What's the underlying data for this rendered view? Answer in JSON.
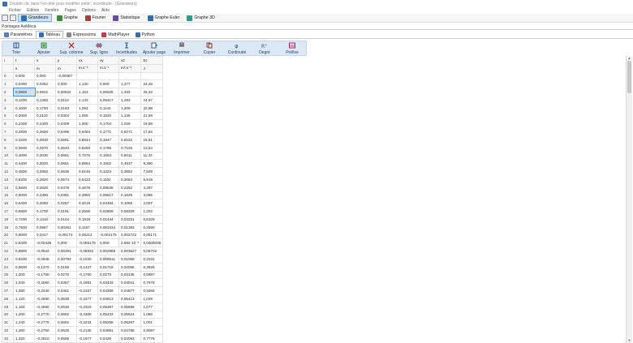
{
  "window": {
    "title": "Double clic dans l'en-tête pour modifier unité ; incertitude - [Grandeurs]"
  },
  "menu": [
    "Fichier",
    "Edition",
    "Fenêtre",
    "Pages",
    "Options",
    "Aide"
  ],
  "topbar": {
    "buttons": [
      {
        "label": "Grandeurs",
        "icon": "table-icon",
        "active": true,
        "color": "#2f6db5"
      },
      {
        "label": "Graphe",
        "icon": "graph-icon",
        "active": false,
        "color": "#3a8a3a"
      },
      {
        "label": "Fourier",
        "icon": "fourier-icon",
        "active": false,
        "color": "#b23a3a"
      },
      {
        "label": "Statistique",
        "icon": "stats-icon",
        "active": false,
        "color": "#6a4aa8"
      },
      {
        "label": "Graphe Euler",
        "icon": "euler-icon",
        "active": false,
        "color": "#2f6db5"
      },
      {
        "label": "Graphe 3D",
        "icon": "graph3d-icon",
        "active": false,
        "color": "#2f9a8a"
      }
    ]
  },
  "section": {
    "label": "Pointages AviMéca"
  },
  "tabs": [
    {
      "label": "Paramètres",
      "icon": "params-icon",
      "active": false
    },
    {
      "label": "Tableau",
      "icon": "table-icon",
      "active": true
    },
    {
      "label": "Expressions",
      "icon": "expressions-icon",
      "active": false
    },
    {
      "label": "MathPlayer",
      "icon": "mathplayer-icon",
      "active": false
    },
    {
      "label": "Python",
      "icon": "python-icon",
      "active": false
    }
  ],
  "toolbar": [
    {
      "label": "Trier",
      "icon": "sort-icon",
      "color": "#2a55a0"
    },
    {
      "label": "Ajouter",
      "icon": "add-icon",
      "color": "#2a8a3a"
    },
    {
      "label": "Sup. colonne",
      "icon": "delete-column-icon",
      "color": "#c03030"
    },
    {
      "label": "Sup. ligne",
      "icon": "delete-row-icon",
      "color": "#c03030"
    },
    {
      "label": "Incertitudes",
      "icon": "uncertainty-icon",
      "color": "#2a55a0"
    },
    {
      "label": "Ajouter page",
      "icon": "add-page-icon",
      "color": "#2a55a0"
    },
    {
      "label": "Imprimer",
      "icon": "print-icon",
      "color": "#444444"
    },
    {
      "label": "Copier",
      "icon": "copy-icon",
      "color": "#7a3a3a"
    },
    {
      "label": "Continuité",
      "icon": "continuity-icon",
      "color": "#2a55a0"
    },
    {
      "label": "Degré",
      "icon": "degree-icon",
      "color": "#2a55a0"
    },
    {
      "label": "Préfixe",
      "icon": "prefix-icon",
      "color": "#a03070"
    }
  ],
  "table": {
    "headers": [
      "i",
      "t",
      "x",
      "y",
      "vx",
      "vy",
      "v2",
      "Ec"
    ],
    "units": [
      "",
      "s",
      "m",
      "m",
      "m.s⁻¹",
      "m.s⁻¹",
      "m².s⁻²",
      "J"
    ],
    "rows": [
      [
        "0",
        "0,000",
        "0,000",
        "-0,00087",
        "",
        "",
        "",
        ""
      ],
      [
        "1",
        "0,0400",
        "0,0452",
        "0,000",
        "1,130",
        "0,000",
        "1,277",
        "24,26"
      ],
      [
        "2",
        "0,0800",
        "0,0922",
        "0,00522",
        "1,153",
        "0,06525",
        "1,333",
        "25,32"
      ],
      [
        "3",
        "0,1200",
        "0,1360",
        "0,0113",
        "1,133",
        "0,09417",
        "1,293",
        "24,57"
      ],
      [
        "4",
        "0,1600",
        "0,1750",
        "0,0183",
        "1,094",
        "0,1144",
        "1,209",
        "22,98"
      ],
      [
        "5",
        "0,2000",
        "0,2110",
        "0,0304",
        "1,055",
        "0,1520",
        "1,136",
        "21,59"
      ],
      [
        "6",
        "0,2400",
        "0,2400",
        "0,0409",
        "1,000",
        "0,1704",
        "1,029",
        "19,55"
      ],
      [
        "7",
        "0,2800",
        "0,2650",
        "0,0496",
        "0,9464",
        "0,1771",
        "0,9271",
        "17,62"
      ],
      [
        "8",
        "0,3200",
        "0,2830",
        "0,0591",
        "0,8844",
        "0,1847",
        "0,8162",
        "15,51"
      ],
      [
        "9",
        "0,3600",
        "0,2970",
        "0,0643",
        "0,8250",
        "0,1786",
        "0,7125",
        "13,54"
      ],
      [
        "10",
        "0,4000",
        "0,3030",
        "0,0661",
        "0,7575",
        "0,1653",
        "0,6011",
        "11,42"
      ],
      [
        "11",
        "0,4400",
        "0,3020",
        "0,0661",
        "0,6864",
        "0,1502",
        "0,4937",
        "9,380"
      ],
      [
        "12",
        "0,4800",
        "0,2950",
        "0,0635",
        "0,6146",
        "0,1323",
        "0,3952",
        "7,509"
      ],
      [
        "13",
        "0,5200",
        "0,2820",
        "0,0574",
        "0,5423",
        "0,1104",
        "0,3063",
        "5,819"
      ],
      [
        "14",
        "0,5600",
        "0,2620",
        "0,0478",
        "0,4679",
        "0,08536",
        "0,2262",
        "4,297"
      ],
      [
        "15",
        "0,6000",
        "0,2390",
        "0,0391",
        "0,3983",
        "0,06517",
        "0,1629",
        "3,095"
      ],
      [
        "16",
        "0,6400",
        "0,2060",
        "0,0287",
        "0,3219",
        "0,04484",
        "0,1056",
        "2,007"
      ],
      [
        "17",
        "0,6800",
        "0,1700",
        "0,0191",
        "0,2500",
        "0,02809",
        "0,06329",
        "1,202"
      ],
      [
        "18",
        "0,7200",
        "0,1310",
        "0,0104",
        "0,1819",
        "0,01444",
        "0,03331",
        "0,6329"
      ],
      [
        "19",
        "0,7600",
        "0,0887",
        "0,00261",
        "0,1167",
        "0,003434",
        "0,01363",
        "0,2590"
      ],
      [
        "20",
        "0,8000",
        "0,0417",
        "-0,00174",
        "0,05212",
        "-0,002175",
        "0,002722",
        "0,05171"
      ],
      [
        "21",
        "0,8400",
        "-0,00435",
        "0,000",
        "-0,005179",
        "0,000",
        "2,682·10⁻⁵",
        "0,0005095"
      ],
      [
        "22",
        "0,8800",
        "-0,0522",
        "0,00261",
        "-0,05932",
        "0,002966",
        "0,003527",
        "0,06702"
      ],
      [
        "23",
        "0,9200",
        "-0,0948",
        "0,00783",
        "-0,1030",
        "0,008511",
        "0,01069",
        "0,2031"
      ],
      [
        "24",
        "0,9600",
        "-0,1370",
        "0,0165",
        "-0,1427",
        "0,01719",
        "0,02066",
        "0,3926"
      ],
      [
        "25",
        "1,000",
        "-0,1750",
        "0,0270",
        "-0,1750",
        "0,0270",
        "0,03135",
        "0,5957"
      ],
      [
        "26",
        "1,040",
        "-0,2060",
        "0,0357",
        "-0,1981",
        "0,03433",
        "0,04041",
        "0,7678"
      ],
      [
        "27",
        "1,080",
        "-0,2340",
        "0,0461",
        "-0,2167",
        "0,04269",
        "0,04877",
        "0,9266"
      ],
      [
        "28",
        "1,120",
        "-0,2550",
        "0,0539",
        "-0,2277",
        "0,04813",
        "0,05413",
        "1,029"
      ],
      [
        "29",
        "1,160",
        "-0,2690",
        "0,0626",
        "-0,2319",
        "0,05397",
        "0,05669",
        "1,077"
      ],
      [
        "30",
        "1,200",
        "-0,2770",
        "0,0652",
        "-0,2308",
        "0,05433",
        "0,05624",
        "1,068"
      ],
      [
        "31",
        "1,240",
        "-0,2770",
        "0,0652",
        "-0,2234",
        "0,05258",
        "0,05267",
        "1,001"
      ],
      [
        "32",
        "1,280",
        "-0,2750",
        "0,0626",
        "-0,2135",
        "0,04891",
        "0,04788",
        "0,9097"
      ],
      [
        "33",
        "1,320",
        "-0,2610",
        "0,0565",
        "-0,1977",
        "0,0428",
        "0,04093",
        "0,7776"
      ]
    ],
    "selected_cell": {
      "row": 2,
      "col": 1
    }
  }
}
